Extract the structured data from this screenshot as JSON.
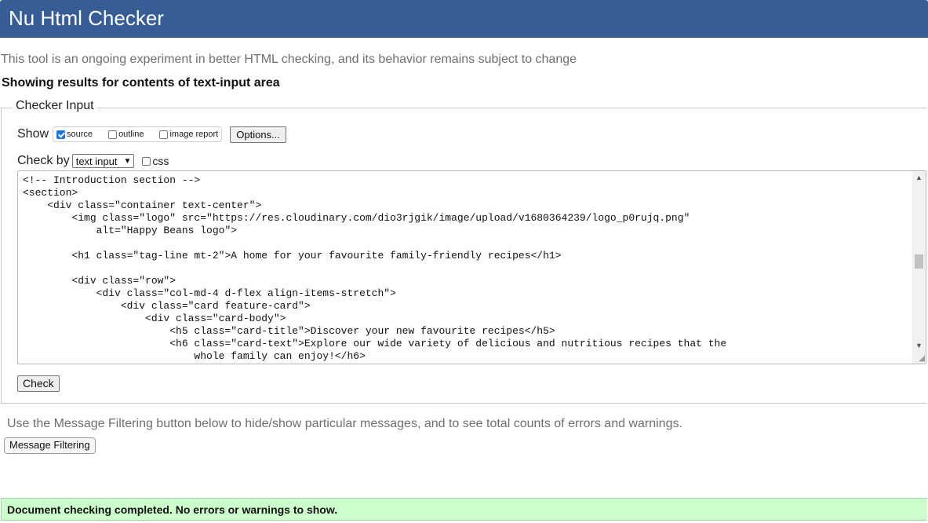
{
  "header": {
    "title": "Nu Html Checker"
  },
  "intro": {
    "tagline": "This tool is an ongoing experiment in better HTML checking, and its behavior remains subject to change",
    "showing": "Showing results for contents of text-input area"
  },
  "checker_input": {
    "legend": "Checker Input",
    "show_label": "Show",
    "show_options": [
      {
        "label": "source",
        "checked": true
      },
      {
        "label": "outline",
        "checked": false
      },
      {
        "label": "image report",
        "checked": false
      }
    ],
    "options_button": "Options...",
    "check_by_label": "Check by",
    "check_by_select": "text input",
    "css_label": "css",
    "css_checked": false,
    "source_code": "<!-- Introduction section -->\n<section>\n    <div class=\"container text-center\">\n        <img class=\"logo\" src=\"https://res.cloudinary.com/dio3rjgik/image/upload/v1680364239/logo_p0rujq.png\"\n            alt=\"Happy Beans logo\">\n\n        <h1 class=\"tag-line mt-2\">A home for your favourite family-friendly recipes</h1>\n\n        <div class=\"row\">\n            <div class=\"col-md-4 d-flex align-items-stretch\">\n                <div class=\"card feature-card\">\n                    <div class=\"card-body\">\n                        <h5 class=\"card-title\">Discover your new favourite recipes</h5>\n                        <h6 class=\"card-text\">Explore our wide variety of delicious and nutritious recipes that the\n                            whole family can enjoy!</h6>",
    "check_button": "Check"
  },
  "filtering": {
    "text": "Use the Message Filtering button below to hide/show particular messages, and to see total counts of errors and warnings.",
    "button": "Message Filtering"
  },
  "result": {
    "message": "Document checking completed. No errors or warnings to show."
  }
}
